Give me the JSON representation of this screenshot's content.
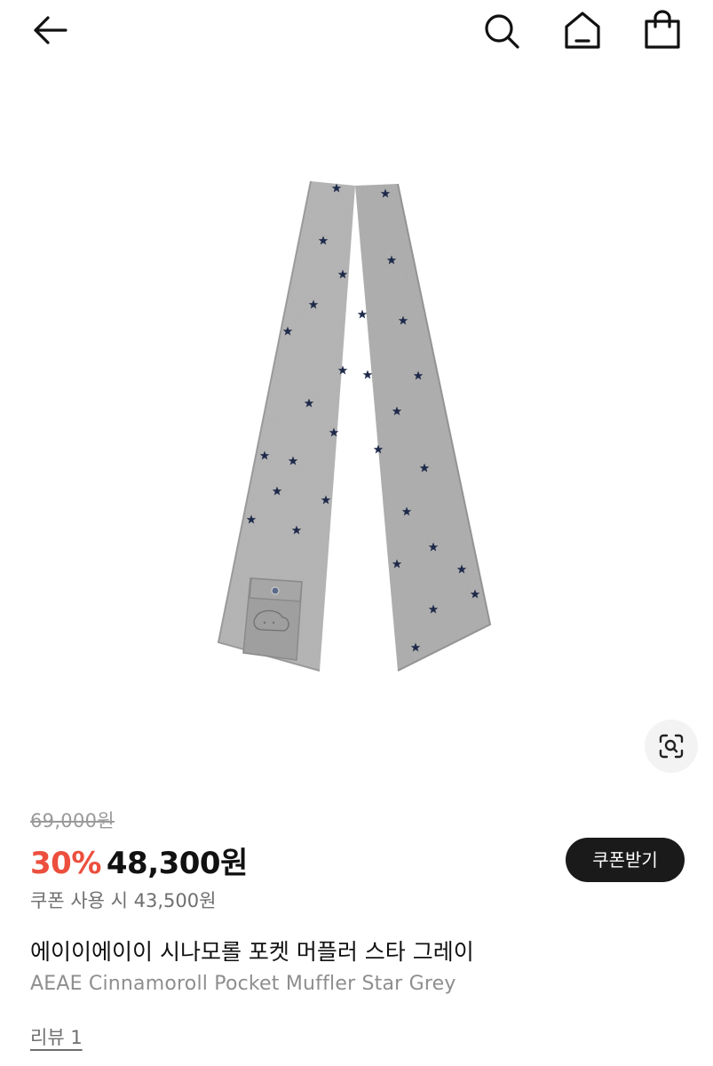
{
  "header": {
    "back_icon": "arrow-left-icon",
    "search_icon": "search-icon",
    "home_icon": "home-icon",
    "bag_icon": "shopping-bag-icon"
  },
  "product": {
    "image_alt": "에이이에이이 시나모롤 포켓 머플러 스타 그레이",
    "image_colors": {
      "body": "#a9a9a9",
      "stars": "#1f2a4a"
    },
    "lens_icon": "image-search-icon",
    "original_price": "69,000원",
    "discount": "30%",
    "price": "48,300원",
    "coupon_button": "쿠폰받기",
    "coupon_price": "쿠폰 사용 시 43,500원",
    "title_kr": "에이이에이이 시나모롤 포켓 머플러 스타 그레이",
    "title_en": "AEAE Cinnamoroll Pocket Muffler Star Grey",
    "review": "리뷰 1"
  },
  "colors": {
    "discount": "#ec4f3d",
    "coupon_button_bg": "#1a1a1a",
    "text_primary": "#111111",
    "text_secondary": "#8e8e8e"
  }
}
